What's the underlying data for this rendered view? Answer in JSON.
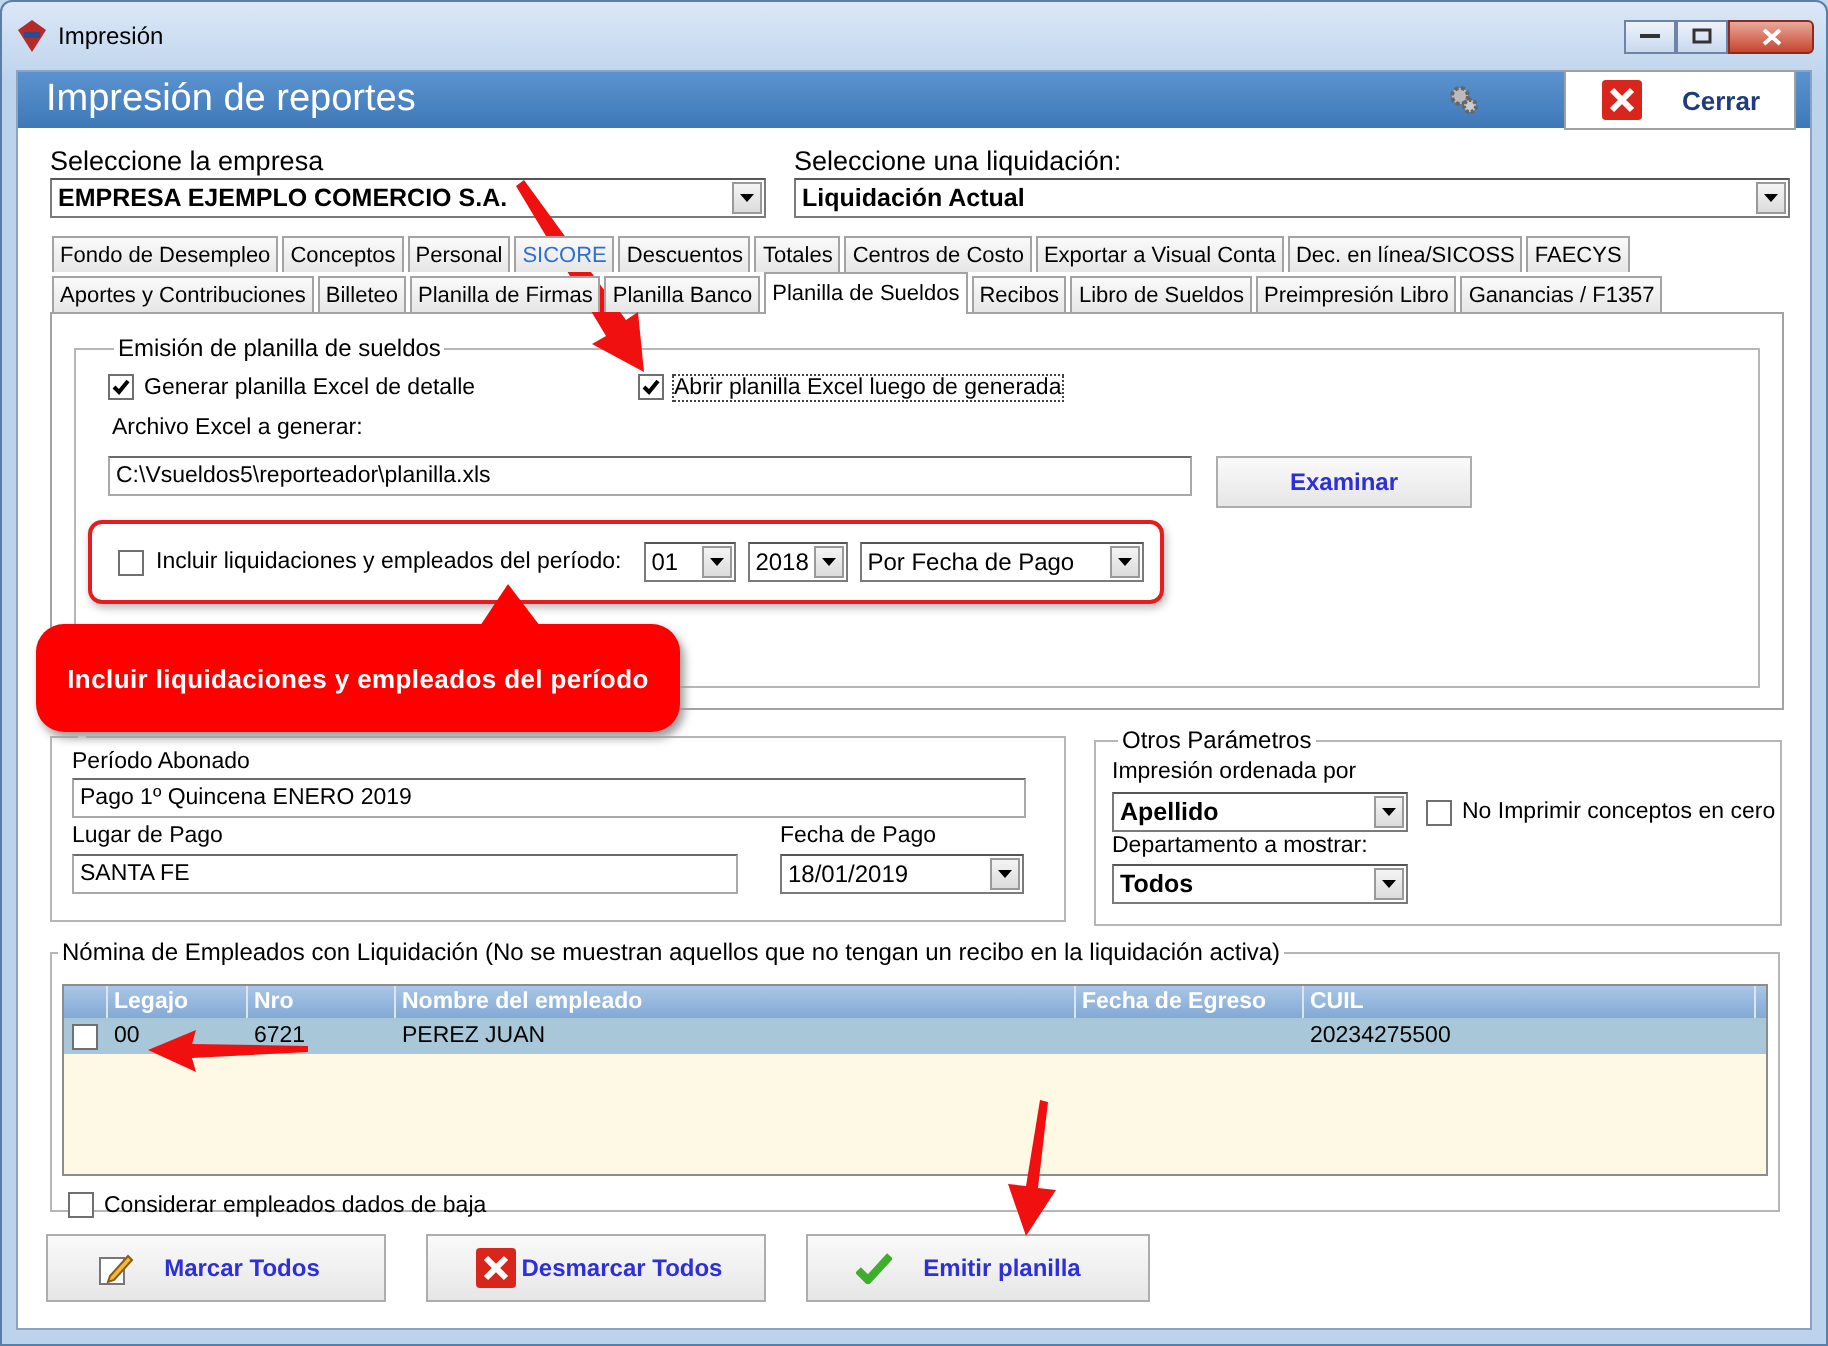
{
  "window": {
    "title": "Impresión"
  },
  "header": {
    "title": "Impresión de reportes",
    "close_button": "Cerrar"
  },
  "company": {
    "label": "Seleccione la empresa",
    "value": "EMPRESA EJEMPLO COMERCIO S.A."
  },
  "liquidation": {
    "label": "Seleccione una liquidación:",
    "value": "Liquidación Actual"
  },
  "tab_rows": [
    [
      {
        "label": "Fondo de Desempleo",
        "selected": false,
        "kind": "tab"
      },
      {
        "label": "Conceptos",
        "selected": false,
        "kind": "tab"
      },
      {
        "label": "Personal",
        "selected": false,
        "kind": "tab"
      },
      {
        "label": "SICORE",
        "selected": false,
        "kind": "link"
      },
      {
        "label": "Descuentos",
        "selected": false,
        "kind": "tab"
      },
      {
        "label": "Totales",
        "selected": false,
        "kind": "tab"
      },
      {
        "label": "Centros de Costo",
        "selected": false,
        "kind": "tab"
      },
      {
        "label": "Exportar a Visual Conta",
        "selected": false,
        "kind": "tab"
      },
      {
        "label": "Dec. en línea/SICOSS",
        "selected": false,
        "kind": "tab"
      },
      {
        "label": "FAECYS",
        "selected": false,
        "kind": "tab"
      }
    ],
    [
      {
        "label": "Aportes y Contribuciones",
        "selected": false,
        "kind": "tab"
      },
      {
        "label": "Billeteo",
        "selected": false,
        "kind": "tab"
      },
      {
        "label": "Planilla de Firmas",
        "selected": false,
        "kind": "tab"
      },
      {
        "label": "Planilla Banco",
        "selected": false,
        "kind": "tab"
      },
      {
        "label": "Planilla de Sueldos",
        "selected": true,
        "kind": "tab"
      },
      {
        "label": "Recibos",
        "selected": false,
        "kind": "tab"
      },
      {
        "label": "Libro de Sueldos",
        "selected": false,
        "kind": "tab"
      },
      {
        "label": "Preimpresión Libro",
        "selected": false,
        "kind": "tab"
      },
      {
        "label": "Ganancias / F1357",
        "selected": false,
        "kind": "tab"
      }
    ]
  ],
  "emission": {
    "title": "Emisión de planilla de sueldos",
    "options": [
      {
        "label": "Generar planilla Excel de detalle",
        "checked": true
      },
      {
        "label": "Abrir planilla Excel luego de generada",
        "checked": true
      }
    ],
    "file_label": "Archivo Excel a generar:",
    "file_value": "C:\\Vsueldos5\\reporteador\\planilla.xls",
    "browse_button": "Examinar",
    "period": {
      "label": "Incluir liquidaciones y empleados del período:",
      "checked": false,
      "month": "01",
      "year": "2018",
      "mode": "Por Fecha de Pago"
    }
  },
  "callout": "Incluir liquidaciones y empleados del período",
  "liquidation_data": {
    "period_label": "Período Abonado",
    "period_value": "Pago 1º Quincena ENERO 2019",
    "place_label": "Lugar de Pago",
    "place_value": "SANTA FE",
    "date_label": "Fecha de Pago",
    "date_value": "18/01/2019"
  },
  "other_params": {
    "title": "Otros Parámetros",
    "order_label": "Impresión ordenada por",
    "order_value": "Apellido",
    "zero_label": "No Imprimir conceptos en cero",
    "zero_checked": false,
    "dept_label": "Departamento a mostrar:",
    "dept_value": "Todos"
  },
  "employees": {
    "title": "Nómina de Empleados con Liquidación (No se muestran aquellos que no tengan un recibo en la liquidación activa)",
    "columns": [
      "Legajo",
      "Nro",
      "Nombre del empleado",
      "Fecha de Egreso",
      "CUIL"
    ],
    "rows": [
      {
        "checked": false,
        "selected": true,
        "cells": [
          "00",
          "6721",
          "PEREZ  JUAN",
          "",
          "20234275500"
        ]
      }
    ],
    "include_terminated": {
      "label": "Considerar empleados dados de baja",
      "checked": false
    }
  },
  "buttons": [
    {
      "kind": "edit",
      "label": "Marcar Todos"
    },
    {
      "kind": "remove",
      "label": "Desmarcar Todos"
    },
    {
      "kind": "confirm",
      "label": "Emitir planilla"
    }
  ]
}
